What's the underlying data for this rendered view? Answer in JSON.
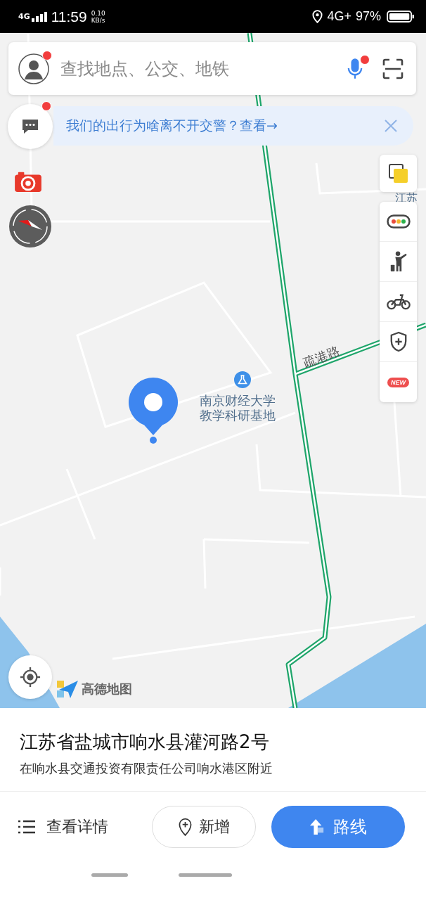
{
  "status_bar": {
    "network_left": "4G",
    "time": "11:59",
    "speed": "0.10",
    "speed_unit": "KB/s",
    "network_right": "4G+",
    "battery": "97%"
  },
  "search": {
    "placeholder": "查找地点、公交、地铁",
    "avatar_badge": true,
    "voice_badge": true
  },
  "notice": {
    "text": "我们的出行为啥离不开交警？查看→",
    "badge": true
  },
  "map": {
    "labels": [
      {
        "kind": "edge",
        "text": "江苏"
      },
      {
        "kind": "road",
        "text": "疏港路"
      },
      {
        "kind": "poi",
        "lines": [
          "南京财经大学",
          "教学科研基地"
        ]
      }
    ],
    "logo": "高德地图"
  },
  "tools": [
    {
      "kind": "traffic"
    },
    {
      "kind": "person"
    },
    {
      "kind": "bike"
    },
    {
      "kind": "shield"
    },
    {
      "kind": "new",
      "badge": "NEW"
    }
  ],
  "place": {
    "title": "江苏省盐城市响水县灌河路2号",
    "subtitle": "在响水县交通投资有限责任公司响水港区附近"
  },
  "actions": [
    {
      "kind": "details",
      "label": "查看详情"
    },
    {
      "kind": "add",
      "label": "新增"
    },
    {
      "kind": "route",
      "label": "路线"
    }
  ]
}
